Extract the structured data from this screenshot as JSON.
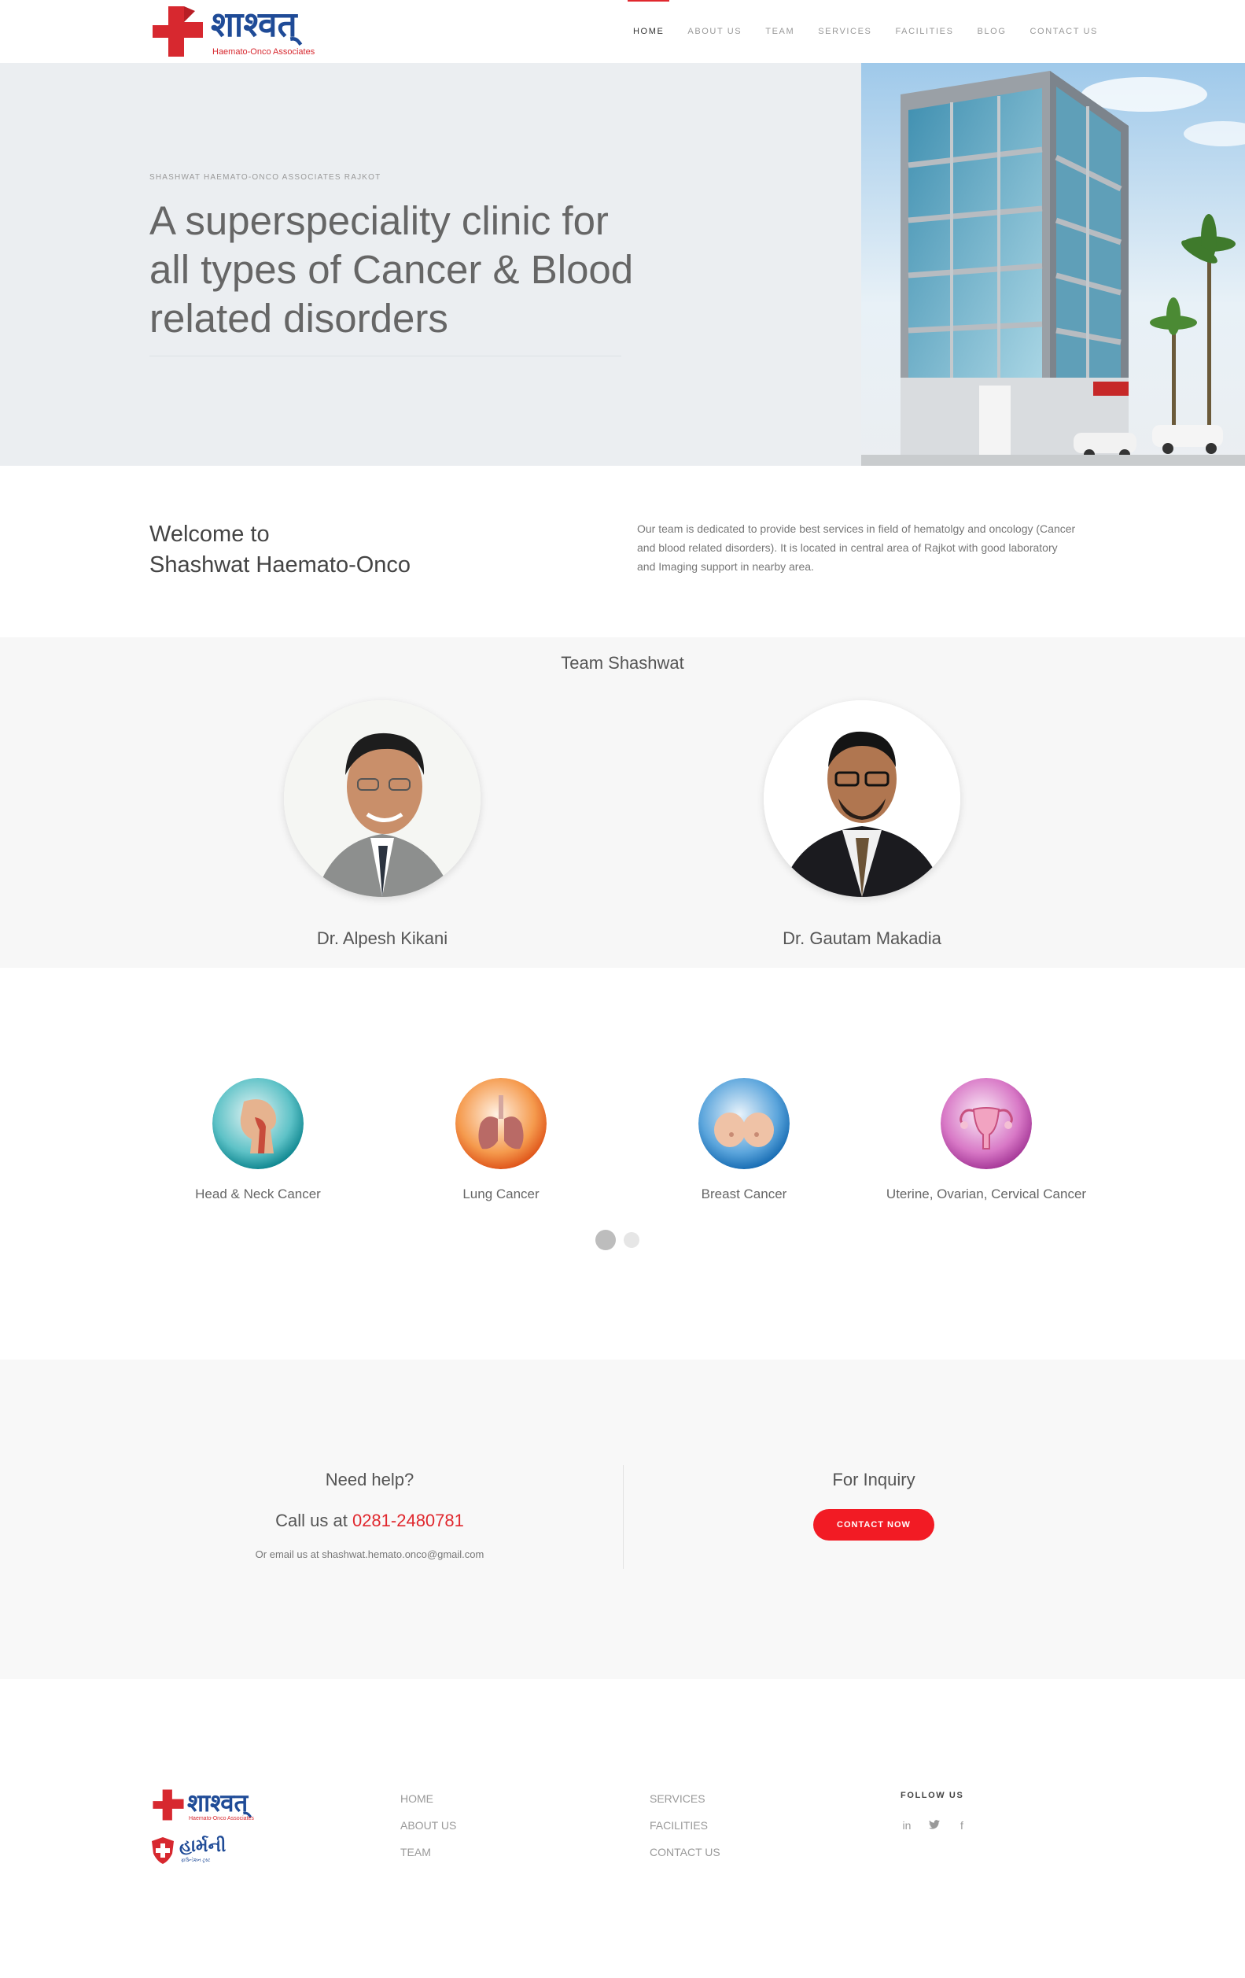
{
  "header": {
    "brand": "शाश्वत्",
    "tagline": "Haemato-Onco Associates",
    "nav": [
      "HOME",
      "ABOUT US",
      "TEAM",
      "SERVICES",
      "FACILITIES",
      "BLOG",
      "CONTACT US"
    ],
    "active_nav": "HOME"
  },
  "hero": {
    "kicker": "SHASHWAT HAEMATO-ONCO ASSOCIATES RAJKOT",
    "title": "A superspeciality clinic for all types of Cancer & Blood related disorders"
  },
  "welcome": {
    "title_line1": "Welcome to",
    "title_line2": "Shashwat Haemato-Onco",
    "text": "Our team is dedicated to provide best services in field of hematolgy and oncology (Cancer and blood related disorders). It is located in central area of Rajkot with good laboratory and Imaging support in nearby area."
  },
  "team": {
    "title": "Team Shashwat",
    "members": [
      {
        "name": "Dr. Alpesh Kikani"
      },
      {
        "name": "Dr. Gautam Makadia"
      }
    ]
  },
  "services": [
    {
      "label": "Head & Neck Cancer",
      "icon": "head-neck-icon"
    },
    {
      "label": "Lung Cancer",
      "icon": "lungs-icon"
    },
    {
      "label": "Breast Cancer",
      "icon": "breast-icon"
    },
    {
      "label": "Uterine, Ovarian, Cervical Cancer",
      "icon": "uterus-icon"
    }
  ],
  "carousel": {
    "pages": 2,
    "active": 1
  },
  "help": {
    "title": "Need help?",
    "call_prefix": "Call us at ",
    "phone": "0281-2480781",
    "email_text": "Or email us at shashwat.hemato.onco@gmail.com",
    "inquiry_title": "For Inquiry",
    "contact_button": "CONTACT NOW"
  },
  "footer": {
    "brand": "शाश्वत्",
    "tagline": "Haemato-Onco Associates",
    "brand2": "હાર્મની",
    "tagline2": "ફાઉન્ડેશન ટ્રસ્ટ",
    "col1": [
      "HOME",
      "ABOUT US",
      "TEAM"
    ],
    "col2": [
      "SERVICES",
      "FACILITIES",
      "CONTACT US"
    ],
    "follow": "FOLLOW US",
    "social": [
      {
        "icon": "linkedin-icon",
        "glyph": "in"
      },
      {
        "icon": "twitter-icon",
        "glyph": "🐦"
      },
      {
        "icon": "facebook-icon",
        "glyph": "f"
      }
    ]
  },
  "colors": {
    "accent": "#e0282e",
    "brand_blue": "#1f4b97",
    "button_red": "#f21b24"
  }
}
